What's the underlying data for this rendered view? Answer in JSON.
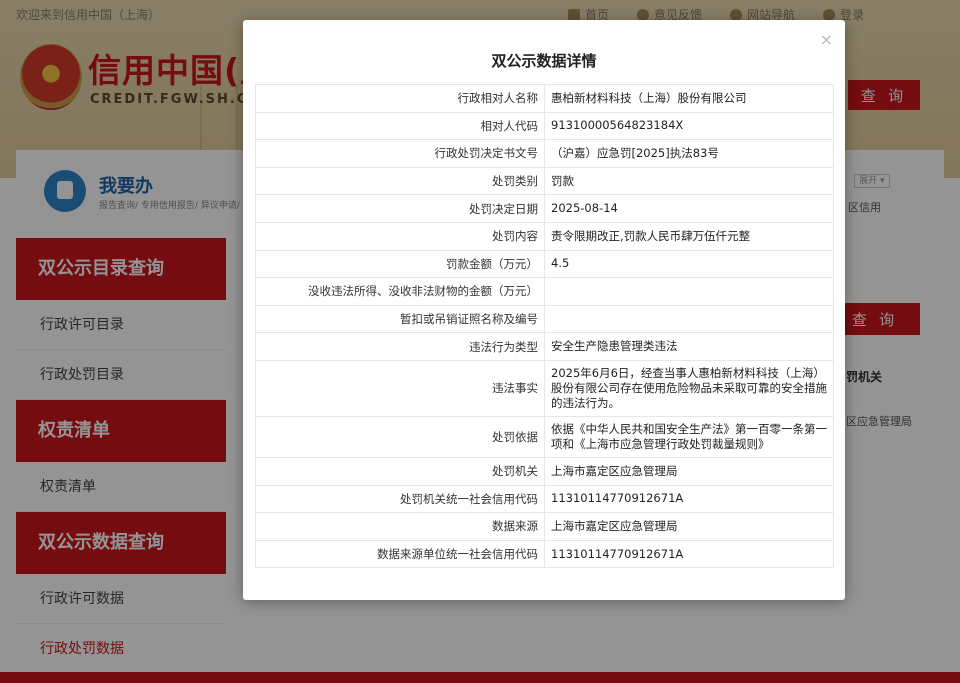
{
  "topbar": {
    "welcome": "欢迎来到信用中国（上海）",
    "nav": [
      "首页",
      "意见反馈",
      "网站导航",
      "登录"
    ]
  },
  "site": {
    "name_cn": "信用中国(上海",
    "name_en": "CREDIT.FGW.SH.GOV.C",
    "query_label": "查 询"
  },
  "workbox": {
    "title": "我要办",
    "sub": "报告查询/ 专用信用报告/ 异议申请/",
    "expand": "展开 ▾",
    "frag_1": "区信用"
  },
  "sidebar": [
    {
      "type": "head",
      "label": "双公示目录查询"
    },
    {
      "type": "item",
      "label": "行政许可目录"
    },
    {
      "type": "item",
      "label": "行政处罚目录"
    },
    {
      "type": "head",
      "label": "权责清单"
    },
    {
      "type": "item",
      "label": "权责清单"
    },
    {
      "type": "head",
      "label": "双公示数据查询"
    },
    {
      "type": "item",
      "label": "行政许可数据"
    },
    {
      "type": "item",
      "label": "行政处罚数据",
      "active": true
    }
  ],
  "right_fragments": {
    "query_label": "查 询",
    "col_header": "罚机关",
    "cell": "区应急管理局"
  },
  "modal": {
    "title": "双公示数据详情",
    "close": "×",
    "rows": [
      {
        "key": "行政相对人名称",
        "value": "惠柏新材料科技（上海）股份有限公司"
      },
      {
        "key": "相对人代码",
        "value": "91310000564823184X"
      },
      {
        "key": "行政处罚决定书文号",
        "value": "（沪嘉）应急罚[2025]执法83号"
      },
      {
        "key": "处罚类别",
        "value": "罚款"
      },
      {
        "key": "处罚决定日期",
        "value": "2025-08-14"
      },
      {
        "key": "处罚内容",
        "value": "责令限期改正,罚款人民币肆万伍仟元整"
      },
      {
        "key": "罚款金额（万元）",
        "value": "4.5"
      },
      {
        "key": "没收违法所得、没收非法财物的金额（万元）",
        "value": ""
      },
      {
        "key": "暂扣或吊销证照名称及编号",
        "value": ""
      },
      {
        "key": "违法行为类型",
        "value": "安全生产隐患管理类违法"
      },
      {
        "key": "违法事实",
        "value": "2025年6月6日，经查当事人惠柏新材料科技（上海）股份有限公司存在使用危险物品未采取可靠的安全措施的违法行为。"
      },
      {
        "key": "处罚依据",
        "value": "依据《中华人民共和国安全生产法》第一百零一条第一项和《上海市应急管理行政处罚裁量规则》"
      },
      {
        "key": "处罚机关",
        "value": "上海市嘉定区应急管理局"
      },
      {
        "key": "处罚机关统一社会信用代码",
        "value": "11310114770912671A"
      },
      {
        "key": "数据来源",
        "value": "上海市嘉定区应急管理局"
      },
      {
        "key": "数据来源单位统一社会信用代码",
        "value": "11310114770912671A"
      }
    ]
  }
}
